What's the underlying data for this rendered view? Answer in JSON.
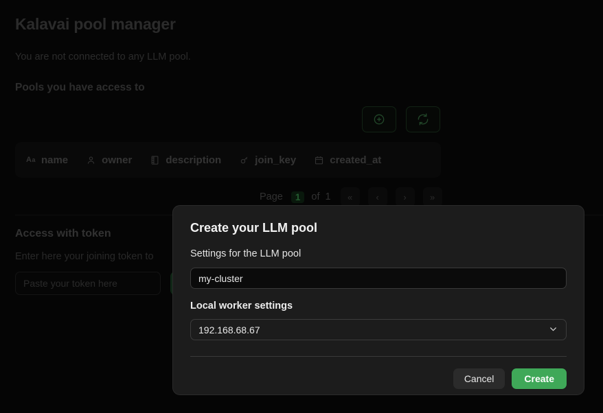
{
  "app": {
    "title": "Kalavai pool manager",
    "connection_status": "You are not connected to any LLM pool.",
    "pools_section_title": "Pools you have access to"
  },
  "toolbar": {
    "add_icon": "plus-circle-icon",
    "refresh_icon": "refresh-icon",
    "accent_color": "#2f6b3a"
  },
  "table": {
    "columns": [
      {
        "label": "name",
        "icon": "text-format-icon"
      },
      {
        "label": "owner",
        "icon": "person-icon"
      },
      {
        "label": "description",
        "icon": "notebook-icon"
      },
      {
        "label": "join_key",
        "icon": "key-icon"
      },
      {
        "label": "created_at",
        "icon": "calendar-icon"
      }
    ],
    "rows": []
  },
  "pagination": {
    "prefix": "Page",
    "current_page": "1",
    "middle": "of",
    "total_pages": "1",
    "first_label": "«",
    "prev_label": "‹",
    "next_label": "›",
    "last_label": "»",
    "badge_color": "#3f9e52"
  },
  "token_section": {
    "title": "Access with token",
    "description": "Enter here your joining token to",
    "input_placeholder": "Paste your token here",
    "input_value": "",
    "submit_label": ""
  },
  "modal": {
    "title": "Create your LLM pool",
    "subtitle": "Settings for the LLM pool",
    "pool_name_value": "my-cluster",
    "pool_name_placeholder": "my-cluster",
    "worker_settings_label": "Local worker settings",
    "worker_address_value": "192.168.68.67",
    "dropdown_icon": "chevron-down-icon",
    "cancel_label": "Cancel",
    "create_label": "Create",
    "create_color": "#3fa858"
  }
}
